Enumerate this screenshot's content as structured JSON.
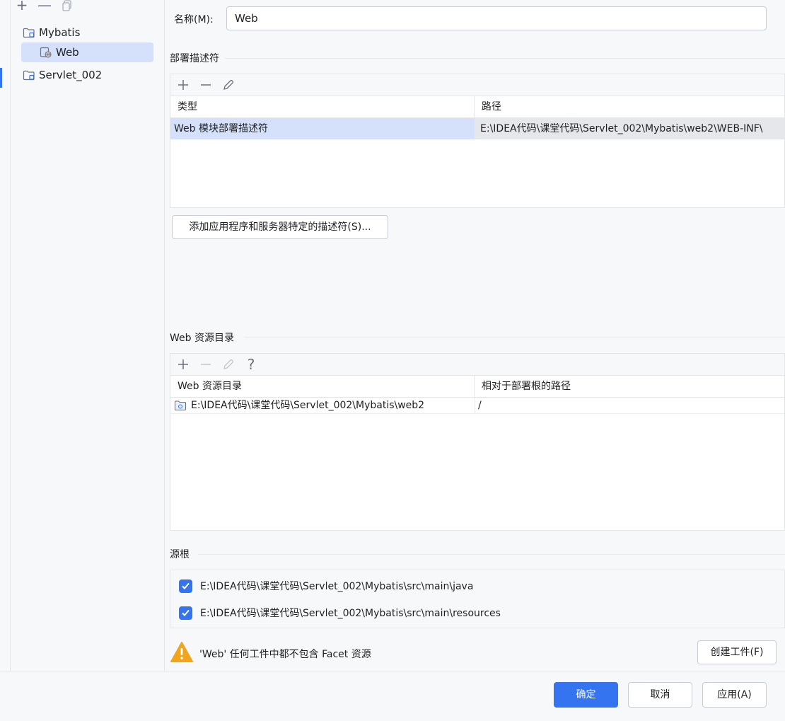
{
  "tree": {
    "toolbar": {
      "add": "+",
      "remove": "—"
    },
    "items": [
      {
        "label": "Mybatis"
      },
      {
        "label": "Web"
      },
      {
        "label": "Servlet_002"
      }
    ]
  },
  "name": {
    "label": "名称(M):",
    "value": "Web"
  },
  "deployment": {
    "title": "部署描述符",
    "columns": [
      "类型",
      "路径"
    ],
    "rows": [
      {
        "type": "Web 模块部署描述符",
        "path": "E:\\IDEA代码\\课堂代码\\Servlet_002\\Mybatis\\web2\\WEB-INF\\"
      }
    ],
    "add_button": "添加应用程序和服务器特定的描述符(S)..."
  },
  "resources": {
    "title": "Web 资源目录",
    "help": "?",
    "columns": [
      "Web 资源目录",
      "相对于部署根的路径"
    ],
    "rows": [
      {
        "dir": "E:\\IDEA代码\\课堂代码\\Servlet_002\\Mybatis\\web2",
        "rel": "/"
      }
    ]
  },
  "source_roots": {
    "title": "源根",
    "items": [
      {
        "path": "E:\\IDEA代码\\课堂代码\\Servlet_002\\Mybatis\\src\\main\\java",
        "checked": true
      },
      {
        "path": "E:\\IDEA代码\\课堂代码\\Servlet_002\\Mybatis\\src\\main\\resources",
        "checked": true
      }
    ]
  },
  "warning": {
    "text": "'Web' 任何工件中都不包含 Facet 资源",
    "create_button": "创建工件(F)"
  },
  "footer": {
    "ok": "确定",
    "cancel": "取消",
    "apply": "应用(A)"
  },
  "colors": {
    "accent": "#3574f0",
    "selection": "#d5e1fb",
    "warning": "#f2a51a"
  }
}
